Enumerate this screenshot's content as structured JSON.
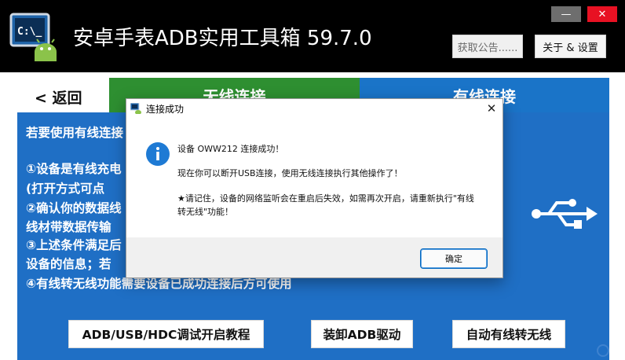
{
  "header": {
    "title": "安卓手表ADB实用工具箱  59.7.0",
    "logo_text": "C:\\_",
    "minimize_label": "—",
    "close_label": "✕",
    "notice_label": "获取公告......",
    "settings_label": "关于 & 设置"
  },
  "nav": {
    "back_label": "< 返回",
    "tabs": [
      {
        "label": "无线连接"
      },
      {
        "label": "有线连接"
      }
    ]
  },
  "main": {
    "lines": [
      "若要使用有线连接",
      "①设备是有线充电",
      "  (打开方式可点",
      "②确认你的数据线",
      "   线材带数据传输",
      "③上述条件满足后",
      "   设备的信息；若",
      "④有线转无线功能需要设备已成功连接后方可使用"
    ],
    "buttons": [
      {
        "label": "ADB/USB/HDC调试开启教程"
      },
      {
        "label": "装卸ADB驱动"
      },
      {
        "label": "自动有线转无线"
      }
    ]
  },
  "dialog": {
    "title": "连接成功",
    "close_label": "✕",
    "messages": [
      "设备 OWW212 连接成功！",
      "现在你可以断开USB连接，使用无线连接执行其他操作了！",
      "★请记住，设备的网络监听会在重启后失效，如需再次开启，请重新执行\"有线",
      "转无线\"功能！"
    ],
    "ok_label": "确定"
  },
  "colors": {
    "header_bg": "#000000",
    "wireless_tab": "#2e8f31",
    "wired_tab": "#1a74c8",
    "panel_bg": "#1f6fc5",
    "close_red": "#e81123",
    "dialog_accent": "#0067c0"
  },
  "icons": {
    "logo": "terminal-android-icon",
    "usb": "usb-icon",
    "info": "info-icon"
  }
}
